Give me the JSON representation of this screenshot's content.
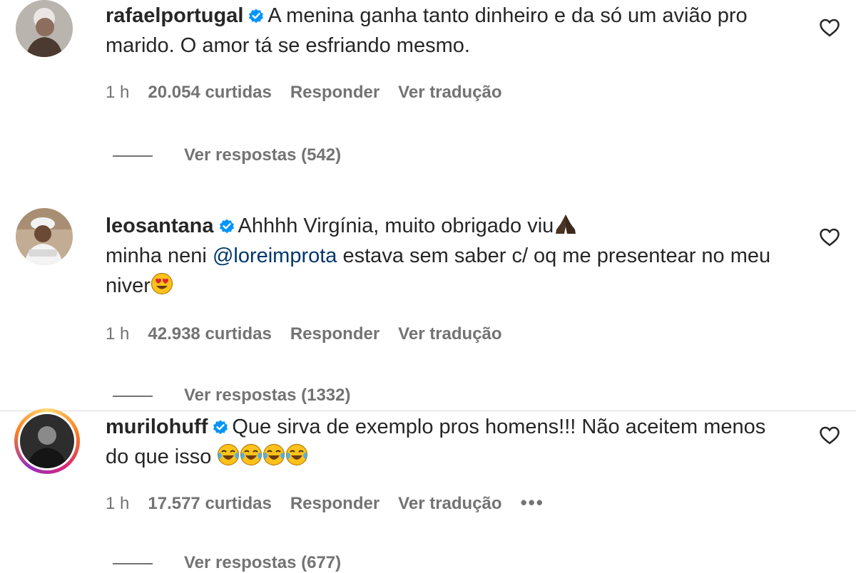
{
  "comments": [
    {
      "username": "rafaelportugal",
      "text": "A menina ganha tanto dinheiro e da só um avião pro marido. O amor tá se esfriando mesmo.",
      "time": "1 h",
      "likes": "20.054 curtidas",
      "reply": "Responder",
      "translate": "Ver tradução",
      "view_replies": "Ver respostas (542)"
    },
    {
      "username": "leosantana",
      "text_a": "Ahhhh Virgínia, muito obrigado viu",
      "text_b": "minha neni",
      "mention": "@loreimprota",
      "text_c": "estava sem saber c/ oq me presentear no meu niver",
      "time": "1 h",
      "likes": "42.938 curtidas",
      "reply": "Responder",
      "translate": "Ver tradução",
      "view_replies": "Ver respostas (1332)"
    },
    {
      "username": "murilohuff",
      "text": "Que sirva de exemplo pros homens!!! Não aceitem menos do que isso",
      "time": "1 h",
      "likes": "17.577 curtidas",
      "reply": "Responder",
      "translate": "Ver tradução",
      "more": "•••",
      "view_replies": "Ver respostas (677)"
    }
  ],
  "icons": {
    "verified": "verified-badge-icon",
    "heart": "heart-outline-icon",
    "pray": "folded-hands-emoji",
    "heart_eyes": "heart-eyes-emoji",
    "laughing": "tears-of-joy-emoji"
  },
  "colors": {
    "text": "#262626",
    "secondary": "#737373",
    "mention": "#00376b",
    "verified": "#0095f6"
  }
}
